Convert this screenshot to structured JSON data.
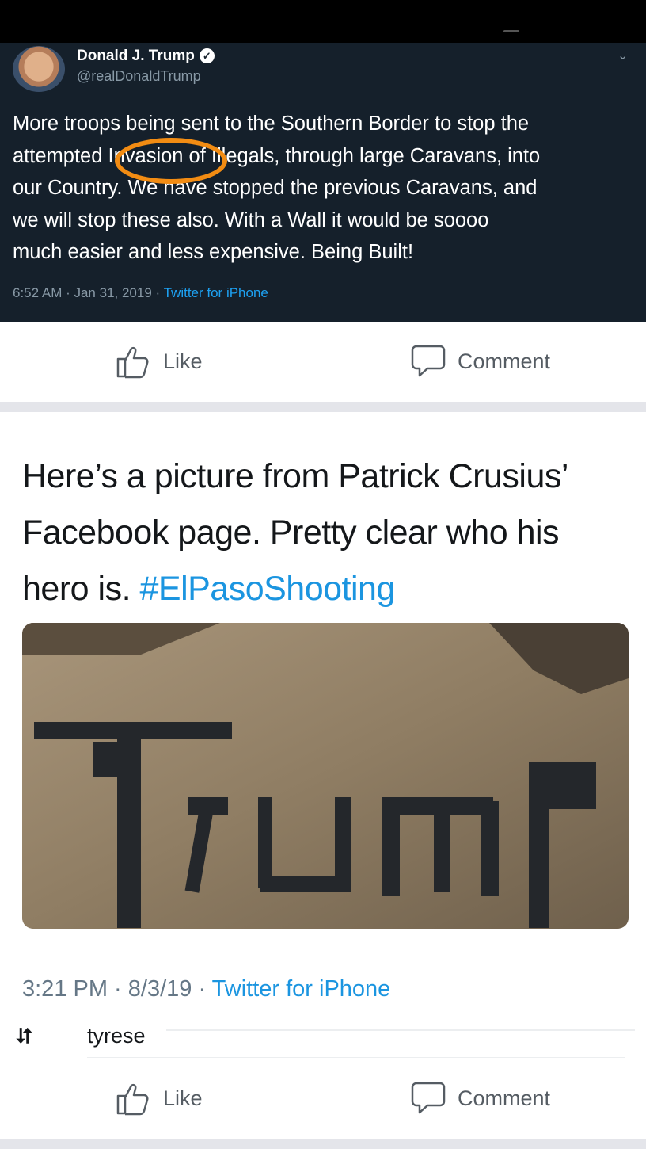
{
  "tweet": {
    "author_name": "Donald J. Trump",
    "handle": "@realDonaldTrump",
    "text_lines": [
      "More troops being sent to the Southern Border to stop the",
      "attempted Invasion of Illegals, through large Caravans, into",
      "our Country. We have stopped the previous Caravans, and",
      "we will stop these also. With a Wall it would be soooo",
      "much easier and less expensive. Being Built!"
    ],
    "timestamp": "6:52 AM · Jan 31, 2019 · ",
    "source": "Twitter for iPhone",
    "icons": {
      "verified": "verified-badge-icon",
      "menu": "chevron-down-icon"
    },
    "highlight_color": "#f28c13"
  },
  "actions_top": {
    "like_label": "Like",
    "comment_label": "Comment"
  },
  "post": {
    "text": "Here’s a picture from Patrick Crusius’ Facebook page. Pretty clear who his hero is. ",
    "hashtag": "#ElPasoShooting",
    "timestamp": "3:21 PM · 8/3/19 · ",
    "source": "Twitter for iPhone",
    "photo_lettering": "Trump"
  },
  "retweet": {
    "icon": "⮃",
    "name": "tyrese"
  },
  "actions_bottom": {
    "like_label": "Like",
    "comment_label": "Comment"
  },
  "colors": {
    "tweet_bg": "#15202b",
    "link": "#1b95e0",
    "divider": "#e4e5ea"
  }
}
